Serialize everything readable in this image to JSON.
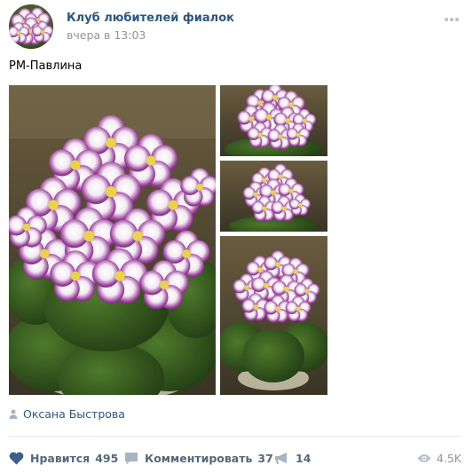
{
  "header": {
    "group_name": "Клуб любителей фиалок",
    "post_time": "вчера в 13:03",
    "more_icon": "more-dots-icon"
  },
  "post": {
    "text": "РМ-Павлина",
    "photos": [
      {
        "name": "photo-main",
        "subject": "violet-plant-closeup"
      },
      {
        "name": "photo-1",
        "subject": "violet-plant"
      },
      {
        "name": "photo-2",
        "subject": "violet-plant"
      },
      {
        "name": "photo-3",
        "subject": "violet-plant"
      }
    ]
  },
  "author": {
    "icon": "user-icon",
    "name": "Оксана Быстрова"
  },
  "actions": {
    "like": {
      "label": "Нравится",
      "count": "495",
      "icon": "heart-icon"
    },
    "comment": {
      "label": "Комментировать",
      "count": "37",
      "icon": "comment-icon"
    },
    "share": {
      "count": "14",
      "icon": "megaphone-icon"
    },
    "views": {
      "count": "4.5K",
      "icon": "eye-icon"
    }
  },
  "colors": {
    "link": "#2a5885",
    "muted": "#939393",
    "action": "#55677d",
    "divider": "#e7e8ec"
  }
}
